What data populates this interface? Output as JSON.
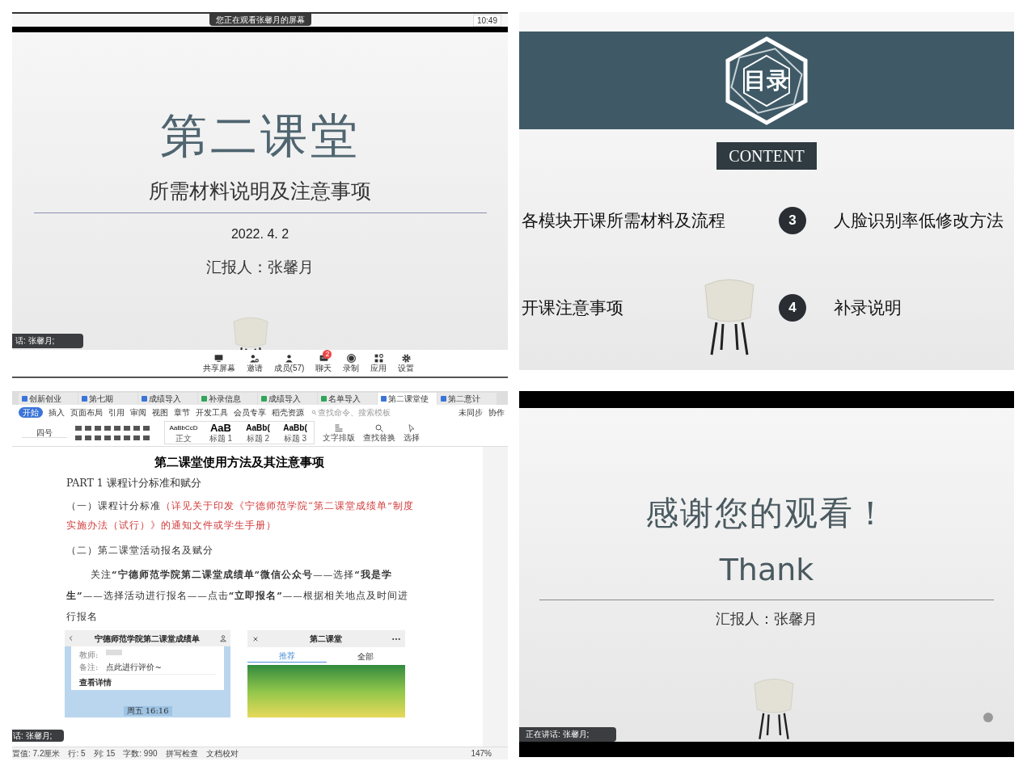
{
  "meeting_view": {
    "share_notice": "您正在观看张馨月的屏幕",
    "time": "10:49",
    "slide": {
      "title": "第二课堂",
      "subtitle": "所需材料说明及注意事项",
      "date": "2022. 4. 2",
      "reporter": "汇报人：张馨月"
    },
    "speaker_tag": "话: 张馨月;",
    "toolbar": [
      {
        "kind": "screen",
        "label": "共享屏幕"
      },
      {
        "kind": "invite",
        "label": "邀请"
      },
      {
        "kind": "members",
        "label": "成员(57)"
      },
      {
        "kind": "chat",
        "label": "聊天",
        "badge": "2"
      },
      {
        "kind": "record",
        "label": "录制"
      },
      {
        "kind": "apps",
        "label": "应用"
      },
      {
        "kind": "settings",
        "label": "设置"
      }
    ]
  },
  "contents_slide": {
    "heading": "目录",
    "badge": "CONTENT",
    "items": [
      {
        "text": "各模块开课所需材料及流程"
      },
      {
        "number": "3",
        "text": "人脸识别率低修改方法"
      },
      {
        "text": "开课注意事项"
      },
      {
        "number": "4",
        "text": "补录说明"
      }
    ]
  },
  "document_window": {
    "tabs": [
      {
        "kind": "doc",
        "label": "创新创业",
        "selected": false
      },
      {
        "kind": "doc",
        "label": "第七期",
        "selected": false
      },
      {
        "kind": "doc",
        "label": "成绩导入",
        "selected": false
      },
      {
        "kind": "sheet",
        "label": "补录信息",
        "selected": false
      },
      {
        "kind": "sheet",
        "label": "成绩导入",
        "selected": false
      },
      {
        "kind": "sheet",
        "label": "名单导入",
        "selected": false
      },
      {
        "kind": "doc",
        "label": "第二课堂使",
        "selected": true
      },
      {
        "kind": "doc",
        "label": "第二意计",
        "selected": false
      }
    ],
    "menu": [
      {
        "label": "开始",
        "selected": true
      },
      {
        "label": "插入",
        "selected": false
      },
      {
        "label": "页面布局",
        "selected": false
      },
      {
        "label": "引用",
        "selected": false
      },
      {
        "label": "审阅",
        "selected": false
      },
      {
        "label": "视图",
        "selected": false
      },
      {
        "label": "章节",
        "selected": false
      },
      {
        "label": "开发工具",
        "selected": false
      },
      {
        "label": "会员专享",
        "selected": false
      },
      {
        "label": "稻壳资源",
        "selected": false
      }
    ],
    "command_search": {
      "placeholder": "查找命令、搜索模板"
    },
    "sync": "未同步",
    "collaborate": "协作",
    "font_size": "四号",
    "styles": [
      {
        "sample": "AaBbCcD",
        "name": "正文"
      },
      {
        "sample": "AaB",
        "name": "标题 1"
      },
      {
        "sample": "AaBb(",
        "name": "标题 2"
      },
      {
        "sample": "AaBb(",
        "name": "标题 3"
      }
    ],
    "tools": [
      {
        "kind": "layout",
        "label": "文字排版"
      },
      {
        "kind": "find",
        "label": "查找替换"
      },
      {
        "kind": "select",
        "label": "选择"
      }
    ],
    "document": {
      "heading": "第二课堂使用方法及其注意事项",
      "part": "PART 1 课程计分标准和赋分",
      "paragraphs": [
        {
          "segments": [
            {
              "kind": "normal",
              "text": "（一）课程计分标准"
            },
            {
              "kind": "reference",
              "text": "（详见关于印发《宁德师范学院“第二课堂成绩单”制度实施办法（试行）》的通知文件或学生手册）"
            }
          ]
        },
        {
          "segments": [
            {
              "kind": "normal",
              "text": "（二）第二课堂活动报名及赋分"
            }
          ]
        },
        {
          "kind": "indented",
          "segments": [
            {
              "kind": "normal",
              "text": "关注**“宁德师范学院第二课堂成绩单”微信公众号**——选择**“我是学生”**——选择活动进行报名——点击**“立即报名”**——根据相关地点及时间进行报名"
            }
          ]
        }
      ],
      "phone_left": {
        "title": "宁德师范学院第二课堂成绩单",
        "teacher_label": "教师:",
        "note_label": "备注:",
        "note": "点此进行评价~",
        "details": "查看详情",
        "timestamp": "周五 16:16"
      },
      "phone_right": {
        "title": "第二课堂",
        "tabs": [
          {
            "label": "推荐",
            "selected": true
          },
          {
            "label": "全部",
            "selected": false
          }
        ]
      }
    },
    "speaker_tag": "话: 张馨月;",
    "status_bar": {
      "position": "置值: 7.2厘米",
      "row": "行: 5",
      "column": "列: 15",
      "word_count": "字数: 990",
      "spell_check": "拼写检查",
      "proofread": "文档校对",
      "zoom": "147%"
    }
  },
  "thanks_slide": {
    "title": "感谢您的观看！",
    "subtitle": "Thank",
    "reporter": "汇报人：张馨月",
    "speaker_tag": "正在讲话: 张馨月;"
  }
}
